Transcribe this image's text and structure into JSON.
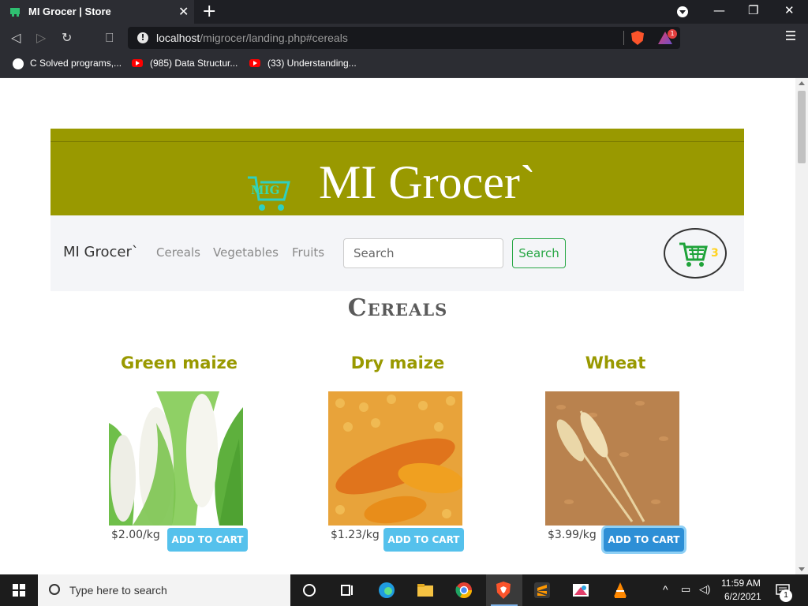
{
  "browser": {
    "tab_title": "MI Grocer | Store",
    "url_host": "localhost",
    "url_path": "/migrocer/landing.php#cereals",
    "rewards_count": "1",
    "bookmarks": [
      {
        "label": "C Solved programs,..."
      },
      {
        "label": "(985) Data Structur..."
      },
      {
        "label": "(33) Understanding..."
      }
    ]
  },
  "banner": {
    "title": "MI Grocer`"
  },
  "navbar": {
    "brand": "MI Grocer`",
    "links": [
      "Cereals",
      "Vegetables",
      "Fruits"
    ],
    "search_placeholder": "Search",
    "search_button": "Search",
    "cart_count": "3"
  },
  "section": {
    "title": "Cereals"
  },
  "products": [
    {
      "name": "Green maize",
      "price": "$2.00/kg",
      "button": "ADD TO CART"
    },
    {
      "name": "Dry maize",
      "price": "$1.23/kg",
      "button": "ADD TO CART"
    },
    {
      "name": "Wheat",
      "price": "$3.99/kg",
      "button": "ADD TO CART"
    }
  ],
  "taskbar": {
    "search_placeholder": "Type here to search",
    "time": "11:59 AM",
    "date": "6/2/2021",
    "notification_count": "1"
  },
  "colors": {
    "banner": "#999900",
    "accent_green": "#28a745",
    "add_button": "#55c1ec"
  }
}
